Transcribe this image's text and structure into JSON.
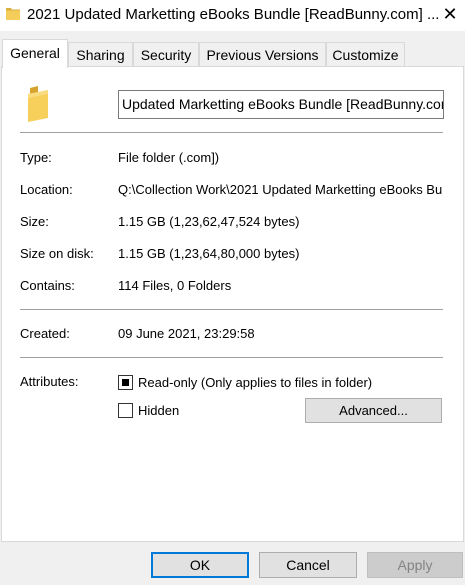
{
  "window": {
    "title": "2021 Updated Marketting eBooks Bundle [ReadBunny.com] ...",
    "close_label": "✕"
  },
  "tabs": [
    {
      "label": "General",
      "active": true
    },
    {
      "label": "Sharing",
      "active": false
    },
    {
      "label": "Security",
      "active": false
    },
    {
      "label": "Previous Versions",
      "active": false
    },
    {
      "label": "Customize",
      "active": false
    }
  ],
  "general": {
    "name_value": "Updated Marketting eBooks Bundle [ReadBunny.com]",
    "type": {
      "label": "Type:",
      "value": "File folder (.com])"
    },
    "location": {
      "label": "Location:",
      "value": "Q:\\Collection Work\\2021 Updated Marketting eBooks Bu"
    },
    "size": {
      "label": "Size:",
      "value": "1.15 GB (1,23,62,47,524 bytes)"
    },
    "size_on_disk": {
      "label": "Size on disk:",
      "value": "1.15 GB (1,23,64,80,000 bytes)"
    },
    "contains": {
      "label": "Contains:",
      "value": "114 Files, 0 Folders"
    },
    "created": {
      "label": "Created:",
      "value": "09 June 2021, 23:29:58"
    },
    "attributes": {
      "label": "Attributes:",
      "readonly_label": "Read-only (Only applies to files in folder)",
      "readonly_state": "indeterminate",
      "hidden_label": "Hidden",
      "hidden_state": "unchecked",
      "advanced_label": "Advanced..."
    }
  },
  "buttons": {
    "ok": "OK",
    "cancel": "Cancel",
    "apply": "Apply"
  },
  "colors": {
    "accent": "#0078d7",
    "folder": "#e8b84b"
  }
}
